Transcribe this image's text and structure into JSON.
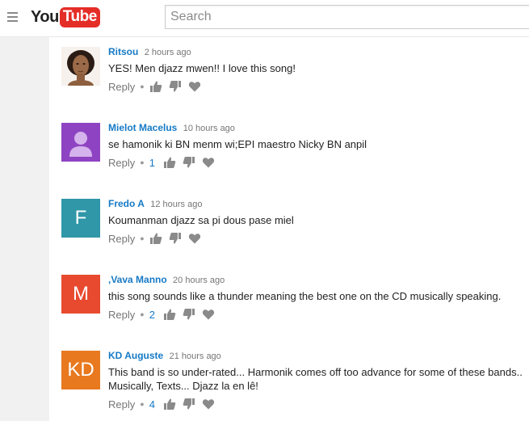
{
  "header": {
    "logo_you": "You",
    "logo_tube": "Tube",
    "search_placeholder": "Search"
  },
  "colors": {
    "link": "#167ac6",
    "youtube_red": "#e52d27",
    "avatar_purple": "#8e44c2",
    "avatar_teal": "#2f97a8",
    "avatar_orange_red": "#e84a2f",
    "avatar_orange": "#e8791f"
  },
  "icons": [
    "hamburger-icon",
    "thumbs-up-icon",
    "thumbs-down-icon",
    "heart-icon",
    "default-user-icon"
  ],
  "comments": [
    {
      "author": "Ritsou",
      "time": "2 hours ago",
      "text_lines": [
        "YES! Men djazz mwen!! I love this song!"
      ],
      "reply": "Reply",
      "likes": "",
      "avatar": "photo"
    },
    {
      "author": "Mielot Macelus",
      "time": "10 hours ago",
      "text_lines": [
        "se hamonik ki BN menm wi;EPI maestro Nicky BN anpil"
      ],
      "reply": "Reply",
      "likes": "1",
      "avatar": "default-user"
    },
    {
      "author": "Fredo A",
      "time": "12 hours ago",
      "text_lines": [
        "Koumanman djazz sa pi dous pase miel"
      ],
      "reply": "Reply",
      "likes": "",
      "avatar_letter": "F"
    },
    {
      "author": ",Vava Manno",
      "time": "20 hours ago",
      "text_lines": [
        "this song sounds like a thunder meaning the best one on the CD musically speaking."
      ],
      "reply": "Reply",
      "likes": "2",
      "avatar_letter": "M"
    },
    {
      "author": "KD Auguste",
      "time": "21 hours ago",
      "text_lines": [
        "This band is so under-rated...  Harmonik comes off too advance for some of these bands..",
        "Musically, Texts... Djazz la en lê!"
      ],
      "reply": "Reply",
      "likes": "4",
      "avatar_letter": "KD"
    }
  ]
}
